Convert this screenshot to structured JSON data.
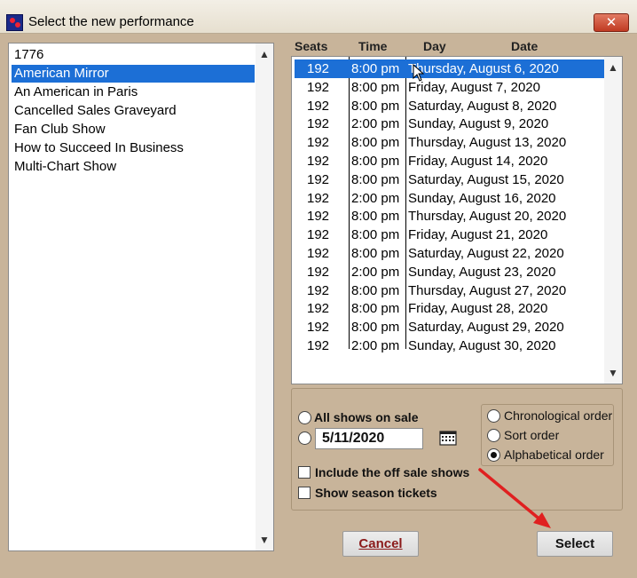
{
  "window": {
    "title": "Select the new performance",
    "close_symbol": "✕"
  },
  "shows": {
    "items": [
      "1776",
      "American Mirror",
      "An American in Paris",
      "Cancelled Sales Graveyard",
      "Fan Club Show",
      "How to Succeed In Business",
      "Multi-Chart Show"
    ],
    "selected_index": 1
  },
  "performances": {
    "headers": {
      "seats": "Seats",
      "time": "Time",
      "day": "Day",
      "date": "Date"
    },
    "rows": [
      {
        "seats": "192",
        "time": "8:00 pm",
        "day_date": "Thursday, August 6, 2020"
      },
      {
        "seats": "192",
        "time": "8:00 pm",
        "day_date": "Friday, August 7, 2020"
      },
      {
        "seats": "192",
        "time": "8:00 pm",
        "day_date": "Saturday, August 8, 2020"
      },
      {
        "seats": "192",
        "time": "2:00 pm",
        "day_date": "Sunday, August 9, 2020"
      },
      {
        "seats": "192",
        "time": "8:00 pm",
        "day_date": "Thursday, August 13, 2020"
      },
      {
        "seats": "192",
        "time": "8:00 pm",
        "day_date": "Friday, August 14, 2020"
      },
      {
        "seats": "192",
        "time": "8:00 pm",
        "day_date": "Saturday, August 15, 2020"
      },
      {
        "seats": "192",
        "time": "2:00 pm",
        "day_date": "Sunday, August 16, 2020"
      },
      {
        "seats": "192",
        "time": "8:00 pm",
        "day_date": "Thursday, August 20, 2020"
      },
      {
        "seats": "192",
        "time": "8:00 pm",
        "day_date": "Friday, August 21, 2020"
      },
      {
        "seats": "192",
        "time": "8:00 pm",
        "day_date": "Saturday, August 22, 2020"
      },
      {
        "seats": "192",
        "time": "2:00 pm",
        "day_date": "Sunday, August 23, 2020"
      },
      {
        "seats": "192",
        "time": "8:00 pm",
        "day_date": "Thursday, August 27, 2020"
      },
      {
        "seats": "192",
        "time": "8:00 pm",
        "day_date": "Friday, August 28, 2020"
      },
      {
        "seats": "192",
        "time": "8:00 pm",
        "day_date": "Saturday, August 29, 2020"
      },
      {
        "seats": "192",
        "time": "2:00 pm",
        "day_date": "Sunday, August 30, 2020"
      }
    ],
    "selected_index": 0
  },
  "filters": {
    "all_shows_label": "All shows on sale",
    "date_value": "5/11/2020",
    "include_off_sale_label": "Include the off sale shows",
    "season_tickets_label": "Show season tickets",
    "all_shows_checked": false,
    "date_checked": false,
    "include_off_sale_checked": false,
    "season_tickets_checked": false
  },
  "sort": {
    "chronological_label": "Chronological order",
    "sort_label": "Sort order",
    "alphabetical_label": "Alphabetical order",
    "selected": "alphabetical"
  },
  "buttons": {
    "cancel_label": "Cancel",
    "select_label": "Select"
  },
  "colors": {
    "selection": "#1c6fd6",
    "dialog_bg": "#c8b49a",
    "arrow": "#e02020"
  }
}
